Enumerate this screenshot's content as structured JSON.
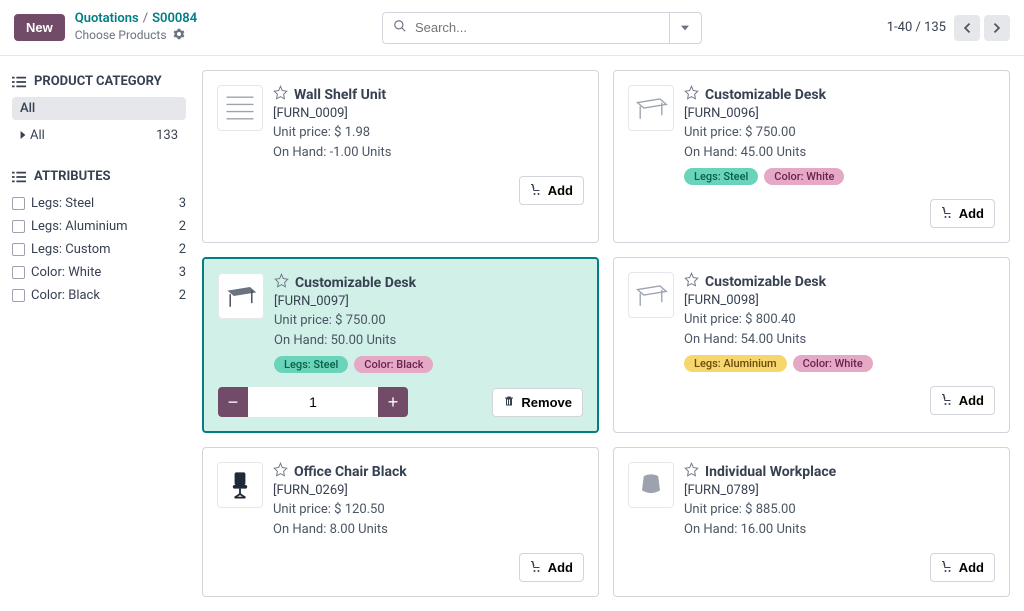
{
  "topbar": {
    "new_label": "New",
    "breadcrumb_root": "Quotations",
    "breadcrumb_id": "S00084",
    "subtitle": "Choose Products",
    "search_placeholder": "Search...",
    "pager_text": "1-40 / 135"
  },
  "sidebar": {
    "category_header": "PRODUCT CATEGORY",
    "cat_all": "All",
    "cat_item": "All",
    "cat_count": "133",
    "attr_header": "ATTRIBUTES",
    "attrs": [
      {
        "label": "Legs: Steel",
        "count": "3"
      },
      {
        "label": "Legs: Aluminium",
        "count": "2"
      },
      {
        "label": "Legs: Custom",
        "count": "2"
      },
      {
        "label": "Color: White",
        "count": "3"
      },
      {
        "label": "Color: Black",
        "count": "2"
      }
    ]
  },
  "buttons": {
    "add": "Add",
    "remove": "Remove"
  },
  "products": [
    {
      "title": "Wall Shelf Unit",
      "sku": "[FURN_0009]",
      "price": "Unit price: $ 1.98",
      "onhand": "On Hand: -1.00 Units",
      "tags": [],
      "selected": false
    },
    {
      "title": "Customizable Desk",
      "sku": "[FURN_0096]",
      "price": "Unit price: $ 750.00",
      "onhand": "On Hand: 45.00 Units",
      "tags": [
        {
          "text": "Legs: Steel",
          "cls": "tag-teal"
        },
        {
          "text": "Color: White",
          "cls": "tag-pink"
        }
      ],
      "selected": false
    },
    {
      "title": "Customizable Desk",
      "sku": "[FURN_0097]",
      "price": "Unit price: $ 750.00",
      "onhand": "On Hand: 50.00 Units",
      "tags": [
        {
          "text": "Legs: Steel",
          "cls": "tag-teal"
        },
        {
          "text": "Color: Black",
          "cls": "tag-pink"
        }
      ],
      "selected": true,
      "qty": "1"
    },
    {
      "title": "Customizable Desk",
      "sku": "[FURN_0098]",
      "price": "Unit price: $ 800.40",
      "onhand": "On Hand: 54.00 Units",
      "tags": [
        {
          "text": "Legs: Aluminium",
          "cls": "tag-yellow"
        },
        {
          "text": "Color: White",
          "cls": "tag-pink"
        }
      ],
      "selected": false
    },
    {
      "title": "Office Chair Black",
      "sku": "[FURN_0269]",
      "price": "Unit price: $ 120.50",
      "onhand": "On Hand: 8.00 Units",
      "tags": [],
      "selected": false
    },
    {
      "title": "Individual Workplace",
      "sku": "[FURN_0789]",
      "price": "Unit price: $ 885.00",
      "onhand": "On Hand: 16.00 Units",
      "tags": [],
      "selected": false
    }
  ]
}
